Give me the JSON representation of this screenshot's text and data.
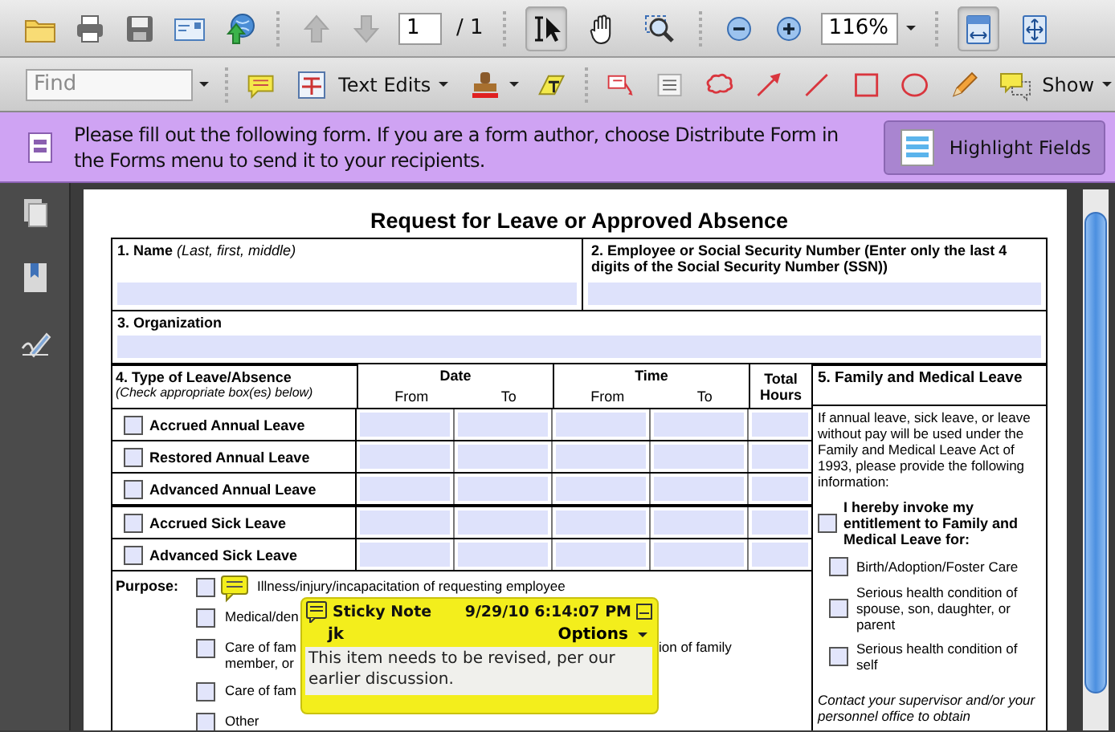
{
  "main_toolbar": {
    "prev_disabled": true,
    "next_disabled": true,
    "page_number": "1",
    "page_total": "/ 1",
    "tools": [
      {
        "kind": "select",
        "selected": true
      },
      {
        "kind": "hand",
        "selected": false
      },
      {
        "kind": "marquee",
        "selected": false
      }
    ],
    "zoom": "116%",
    "views": [
      {
        "kind": "fit-width",
        "selected": true
      },
      {
        "kind": "full-screen",
        "selected": false
      }
    ]
  },
  "comment_toolbar": {
    "find_placeholder": "Find",
    "text_edits": "Text Edits",
    "show": "Show"
  },
  "form_bar": {
    "message": "Please fill out the following form. If you are a form author, choose Distribute Form in the Forms menu to send it to your recipients.",
    "button": "Highlight Fields"
  },
  "form": {
    "title": "Request for Leave or Approved Absence",
    "name_label": "**1. Name** *(Last, first, middle)*",
    "id_label": "2. Employee or Social Security Number (Enter only the last 4 digits of the Social Security Number (SSN))",
    "org_label": "3. Organization",
    "type_heading": "4. Type of Leave/Absence",
    "type_hint": "(Check appropriate box(es) below)",
    "date_heading": "Date",
    "date_from": "From",
    "date_to": "To",
    "time_heading": "Time",
    "time_from": "From",
    "time_to": "To",
    "total_heading": "Total Hours",
    "leave_groups": [
      [
        {
          "label": "Accrued Annual Leave",
          "checked": false
        },
        {
          "label": "Restored Annual Leave",
          "checked": false
        },
        {
          "label": "Advanced Annual Leave",
          "checked": false
        }
      ],
      [
        {
          "label": "Accrued Sick Leave",
          "checked": false
        },
        {
          "label": "Advanced Sick Leave",
          "checked": false
        }
      ]
    ],
    "purpose_label": "Purpose:",
    "purposes": [
      {
        "lines": [
          "Illness/injury/incapacitation of requesting employee"
        ],
        "checked": false
      },
      {
        "lines": [
          "Medical/den"
        ],
        "checked": false
      },
      {
        "lines": [
          "Care of fam",
          "member, or"
        ],
        "tail": "ion of family",
        "checked": false
      },
      {
        "lines": [
          "Care of fam"
        ],
        "checked": false
      },
      {
        "lines": [
          "Other"
        ],
        "checked": false
      }
    ],
    "fmla_heading": "5. Family and Medical Leave",
    "fmla_intro": "If annual leave, sick leave, or leave without pay will be used under the Family and Medical Leave Act of 1993, please provide the following information:",
    "invoke": {
      "label": "I hereby invoke my entitlement to Family and Medical Leave for:",
      "checked": false
    },
    "reasons": [
      {
        "label": "Birth/Adoption/Foster Care",
        "checked": false
      },
      {
        "label": "Serious health condition of spouse, son, daughter, or parent",
        "checked": false
      },
      {
        "label": "Serious health condition of self",
        "checked": false
      }
    ],
    "contact": "Contact your supervisor and/or your personnel office to obtain"
  },
  "sticky_note": {
    "title": "Sticky Note",
    "date": "9/29/10 6:14:07 PM",
    "author": "jk",
    "options": "Options",
    "text": "This item needs to be revised, per our earlier discussion."
  }
}
